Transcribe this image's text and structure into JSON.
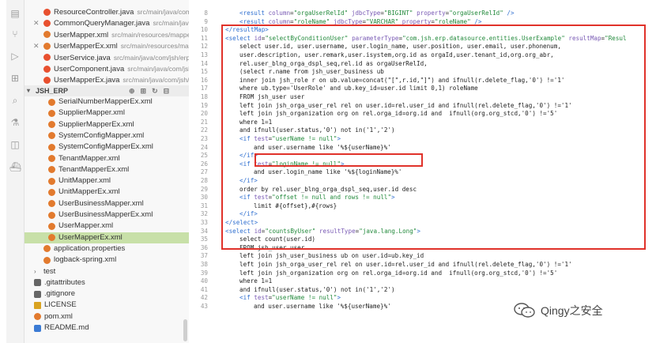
{
  "sidebar": {
    "section_title": "JSH_ERP",
    "top_files": [
      {
        "name": "ResourceController.java",
        "path": "src/main/java/com/...",
        "type": "java",
        "close": false
      },
      {
        "name": "CommonQueryManager.java",
        "path": "src/main/java/...",
        "type": "java",
        "close": true
      },
      {
        "name": "UserMapper.xml",
        "path": "src/main/resources/mappe...",
        "type": "xml",
        "close": false
      },
      {
        "name": "UserMapperEx.xml",
        "path": "src/main/resources/ma...",
        "type": "xml",
        "close": true
      },
      {
        "name": "UserService.java",
        "path": "src/main/java/com/jsh/erp...",
        "type": "java",
        "close": false
      },
      {
        "name": "UserComponent.java",
        "path": "src/main/java/com/jsh...",
        "type": "java",
        "close": false
      },
      {
        "name": "UserMapperEx.java",
        "path": "src/main/java/com/jsh/e...",
        "type": "java",
        "close": false
      }
    ],
    "tree": [
      {
        "name": "SerialNumberMapperEx.xml",
        "type": "xml",
        "indent": 1
      },
      {
        "name": "SupplierMapper.xml",
        "type": "xml",
        "indent": 1
      },
      {
        "name": "SupplierMapperEx.xml",
        "type": "xml",
        "indent": 1
      },
      {
        "name": "SystemConfigMapper.xml",
        "type": "xml",
        "indent": 1
      },
      {
        "name": "SystemConfigMapperEx.xml",
        "type": "xml",
        "indent": 1
      },
      {
        "name": "TenantMapper.xml",
        "type": "xml",
        "indent": 1
      },
      {
        "name": "TenantMapperEx.xml",
        "type": "xml",
        "indent": 1
      },
      {
        "name": "UnitMapper.xml",
        "type": "xml",
        "indent": 1
      },
      {
        "name": "UnitMapperEx.xml",
        "type": "xml",
        "indent": 1
      },
      {
        "name": "UserBusinessMapper.xml",
        "type": "xml",
        "indent": 1
      },
      {
        "name": "UserBusinessMapperEx.xml",
        "type": "xml",
        "indent": 1
      },
      {
        "name": "UserMapper.xml",
        "type": "xml",
        "indent": 1
      },
      {
        "name": "UserMapperEx.xml",
        "type": "xml",
        "indent": 1,
        "selected": true
      },
      {
        "name": "application.properties",
        "type": "xml",
        "indent": 0
      },
      {
        "name": "logback-spring.xml",
        "type": "xml",
        "indent": 0
      },
      {
        "name": "test",
        "type": "folder",
        "indent": -1
      },
      {
        "name": ".gitattributes",
        "type": "git",
        "indent": -2
      },
      {
        "name": ".gitignore",
        "type": "git",
        "indent": -2
      },
      {
        "name": "LICENSE",
        "type": "lic",
        "indent": -2
      },
      {
        "name": "pom.xml",
        "type": "xml",
        "indent": -2
      },
      {
        "name": "README.md",
        "type": "md",
        "indent": -2
      }
    ]
  },
  "editor": {
    "lines": [
      {
        "n": "8",
        "indent": 3,
        "html": "<span class=\"tag\">&lt;result</span> <span class=\"attr\">column</span>=<span class=\"str\">\"orgaUserRelId\"</span> <span class=\"attr\">jdbcType</span>=<span class=\"str\">\"BIGINT\"</span> <span class=\"attr\">property</span>=<span class=\"str\">\"orgaUserRelId\"</span> <span class=\"tag\">/&gt;</span>"
      },
      {
        "n": "9",
        "indent": 3,
        "html": "<span class=\"tag\">&lt;result</span> <span class=\"attr\">column</span>=<span class=\"str\">\"roleName\"</span> <span class=\"attr\">jdbcType</span>=<span class=\"str\">\"VARCHAR\"</span> <span class=\"attr\">property</span>=<span class=\"str\">\"roleName\"</span> <span class=\"tag\">/&gt;</span>"
      },
      {
        "n": "10",
        "indent": 2,
        "html": "<span class=\"tag\">&lt;/resultMap&gt;</span>"
      },
      {
        "n": "11",
        "indent": 2,
        "html": "<span class=\"tag\">&lt;select</span> <span class=\"attr\">id</span>=<span class=\"str\">\"selectByConditionUser\"</span> <span class=\"attr\">parameterType</span>=<span class=\"str\">\"com.jsh.erp.datasource.entities.UserExample\"</span> <span class=\"attr\">resultMap</span>=<span class=\"str\">\"Resul</span>"
      },
      {
        "n": "12",
        "indent": 3,
        "html": "select user.id, user.username, user.login_name, user.position, user.email, user.phonenum,"
      },
      {
        "n": "13",
        "indent": 3,
        "html": "user.description, user.remark,user.isystem,org.id as orgaId,user.tenant_id,org.org_abr,"
      },
      {
        "n": "14",
        "indent": 3,
        "html": "rel.user_blng_orga_dspl_seq,rel.id as orgaUserRelId,"
      },
      {
        "n": "15",
        "indent": 3,
        "html": "(select r.name from jsh_user_business ub"
      },
      {
        "n": "16",
        "indent": 3,
        "html": "inner join jsh_role r on ub.value=concat(\"[\",r.id,\"]\") and ifnull(r.delete_flag,'0') !='1'"
      },
      {
        "n": "17",
        "indent": 3,
        "html": "where ub.type='UserRole' and ub.key_id=user.id limit 0,1) roleName"
      },
      {
        "n": "18",
        "indent": 3,
        "html": "FROM jsh_user user"
      },
      {
        "n": "19",
        "indent": 3,
        "html": "left join jsh_orga_user_rel rel on user.id=rel.user_id and ifnull(rel.delete_flag,'0') !='1'"
      },
      {
        "n": "20",
        "indent": 3,
        "html": "left join jsh_organization org on rel.orga_id=org.id and  ifnull(org.org_stcd,'0') !='5'"
      },
      {
        "n": "21",
        "indent": 3,
        "html": "where 1=1"
      },
      {
        "n": "22",
        "indent": 3,
        "html": "and ifnull(user.status,'0') not in('1','2')"
      },
      {
        "n": "23",
        "indent": 3,
        "html": "<span class=\"tag\">&lt;if</span> <span class=\"attr\">test</span>=<span class=\"str\">\"userName != null\"</span><span class=\"tag\">&gt;</span>"
      },
      {
        "n": "24",
        "indent": 4,
        "html": "and user.username like '%${userName}%'"
      },
      {
        "n": "25",
        "indent": 3,
        "html": "<span class=\"tag\">&lt;/if&gt;</span>"
      },
      {
        "n": "26",
        "indent": 3,
        "html": "<span class=\"tag\">&lt;if</span> <span class=\"attr\">test</span>=<span class=\"str\">\"loginName != null\"</span><span class=\"tag\">&gt;</span>"
      },
      {
        "n": "27",
        "indent": 4,
        "html": "and user.login_name like '%${loginName}%'"
      },
      {
        "n": "28",
        "indent": 3,
        "html": "<span class=\"tag\">&lt;/if&gt;</span>"
      },
      {
        "n": "29",
        "indent": 3,
        "html": "order by rel.user_blng_orga_dspl_seq,user.id desc"
      },
      {
        "n": "30",
        "indent": 3,
        "html": "<span class=\"tag\">&lt;if</span> <span class=\"attr\">test</span>=<span class=\"str\">\"offset != null and rows != null\"</span><span class=\"tag\">&gt;</span>"
      },
      {
        "n": "31",
        "indent": 4,
        "html": "limit #{offset},#{rows}"
      },
      {
        "n": "32",
        "indent": 3,
        "html": "<span class=\"tag\">&lt;/if&gt;</span>"
      },
      {
        "n": "33",
        "indent": 2,
        "html": "<span class=\"tag\">&lt;/select&gt;</span>"
      },
      {
        "n": "34",
        "indent": 2,
        "html": "<span class=\"tag\">&lt;select</span> <span class=\"attr\">id</span>=<span class=\"str\">\"countsByUser\"</span> <span class=\"attr\">resultType</span>=<span class=\"str\">\"java.lang.Long\"</span><span class=\"tag\">&gt;</span>"
      },
      {
        "n": "35",
        "indent": 3,
        "html": "select count(user.id)"
      },
      {
        "n": "36",
        "indent": 3,
        "html": "FROM jsh_user user"
      },
      {
        "n": "37",
        "indent": 3,
        "html": "left join jsh_user_business ub on user.id=ub.key_id"
      },
      {
        "n": "38",
        "indent": 3,
        "html": "left join jsh_orga_user_rel rel on user.id=rel.user_id and ifnull(rel.delete_flag,'0') !='1'"
      },
      {
        "n": "39",
        "indent": 3,
        "html": "left join jsh_organization org on rel.orga_id=org.id and  ifnull(org.org_stcd,'0') !='5'"
      },
      {
        "n": "40",
        "indent": 3,
        "html": "where 1=1"
      },
      {
        "n": "41",
        "indent": 3,
        "html": "and ifnull(user.status,'0') not in('1','2')"
      },
      {
        "n": "42",
        "indent": 3,
        "html": "<span class=\"tag\">&lt;if</span> <span class=\"attr\">test</span>=<span class=\"str\">\"userName != null\"</span><span class=\"tag\">&gt;</span>"
      },
      {
        "n": "43",
        "indent": 4,
        "html": "and user.username like '%${userName}%'"
      }
    ]
  },
  "watermark": {
    "text": "Qingy之安全"
  },
  "colors": {
    "highlight_box": "#e0322a",
    "selected_row": "#c8e0a8"
  }
}
